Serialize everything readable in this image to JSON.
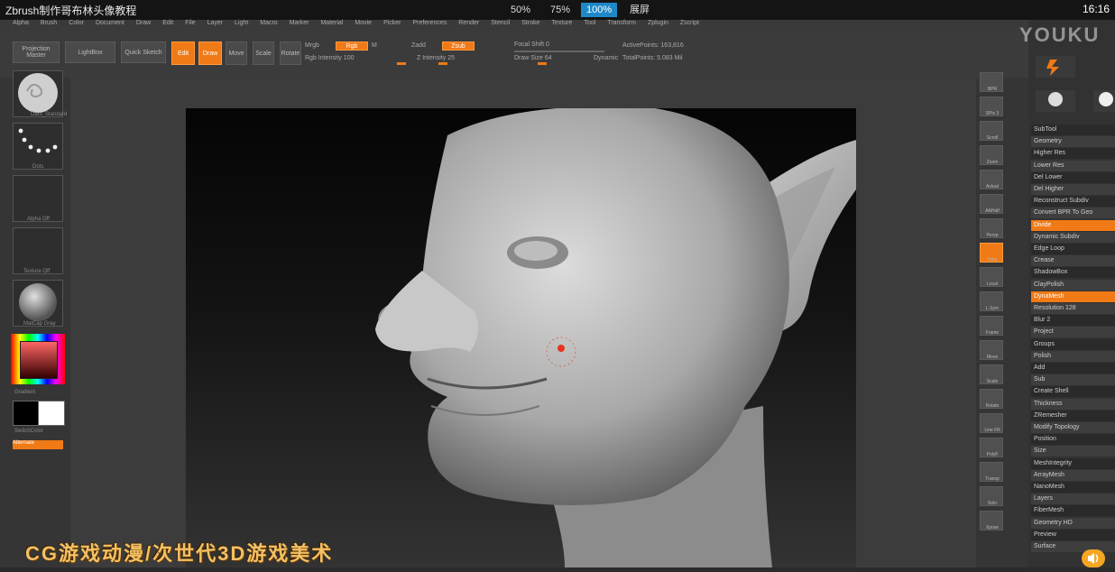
{
  "player": {
    "title": "Zbrush制作哥布林头像教程",
    "zoom_options": [
      "50%",
      "75%",
      "100%"
    ],
    "active_zoom": "100%",
    "fullscreen_label": "展屏",
    "clock": "16:16"
  },
  "zbrush": {
    "menu_items": [
      "Alpha",
      "Brush",
      "Color",
      "Document",
      "Draw",
      "Edit",
      "File",
      "Layer",
      "Light",
      "Macro",
      "Marker",
      "Material",
      "Movie",
      "Picker",
      "Preferences",
      "Render",
      "Stencil",
      "Stroke",
      "Texture",
      "Tool",
      "Transform",
      "Zplugin",
      "Zscript"
    ],
    "toolbar": {
      "projection_master": "Projection Master",
      "lightbox": "LightBox",
      "quick_sketch": "Quick Sketch",
      "edit": "Edit",
      "draw": "Draw",
      "move": "Move",
      "scale": "Scale",
      "rotate": "Rotate",
      "mrgb": "Mrgb",
      "rgb": "Rgb",
      "m": "M",
      "zadd": "Zadd",
      "zsub": "Zsub",
      "z_intensity": "Z Intensity 25",
      "rgb_intensity": "Rgb Intensity 100",
      "focal_shift": "Focal Shift 0",
      "draw_size": "Draw Size 64",
      "dynamic": "Dynamic",
      "active_points": "ActivePoints: 163,816",
      "total_points": "TotalPoints: 5.083 Mil"
    },
    "left_shelf": {
      "labels": [
        "Dam_Standard",
        "Dots",
        "Alpha Off",
        "Texture Off",
        "MatCap Gray"
      ],
      "gradient_label": "Gradient",
      "switch_color": "SwitchColor",
      "alternate": "Alternate"
    },
    "right_shelf": [
      "BPR",
      "SPix 3",
      "Scroll",
      "Zoom",
      "Actual",
      "AAHalf",
      "Persp",
      "Floor",
      "Local",
      "L.Sym",
      "Frame",
      "Move",
      "Scale",
      "Rotate",
      "Line Fill",
      "PolyF",
      "Transp",
      "Solo",
      "Xpose"
    ],
    "palette": {
      "subtool_icons": [
        "Goblin",
        "SimpleBrush",
        "Cylinder3D",
        "PolyMesh3D"
      ],
      "rows": [
        "SubTool",
        "Geometry",
        "Higher Res",
        "Lower Res",
        "Del Lower",
        "Del Higher",
        "Reconstruct Subdiv",
        "Convert BPR To Geo",
        "Divide",
        "Dynamic Subdiv",
        "Edge Loop",
        "Crease",
        "ShadowBox",
        "ClayPolish",
        "DynaMesh",
        "Resolution 128",
        "Blur 2",
        "Project",
        "Groups",
        "Polish",
        "Add",
        "Sub",
        "Create Shell",
        "Thickness",
        "ZRemesher",
        "Modify Topology",
        "Position",
        "Size",
        "MeshIntegrity",
        "ArrayMesh",
        "NanoMesh",
        "Layers",
        "FiberMesh",
        "Geometry HD",
        "Preview",
        "Surface"
      ]
    },
    "banner": "CG游戏动漫/次世代3D游戏美术",
    "watermark": "YOUKU"
  },
  "colors": {
    "accent": "#f07a16",
    "active_zoom": "#1e88c8",
    "banner_text": "#f2c166"
  }
}
